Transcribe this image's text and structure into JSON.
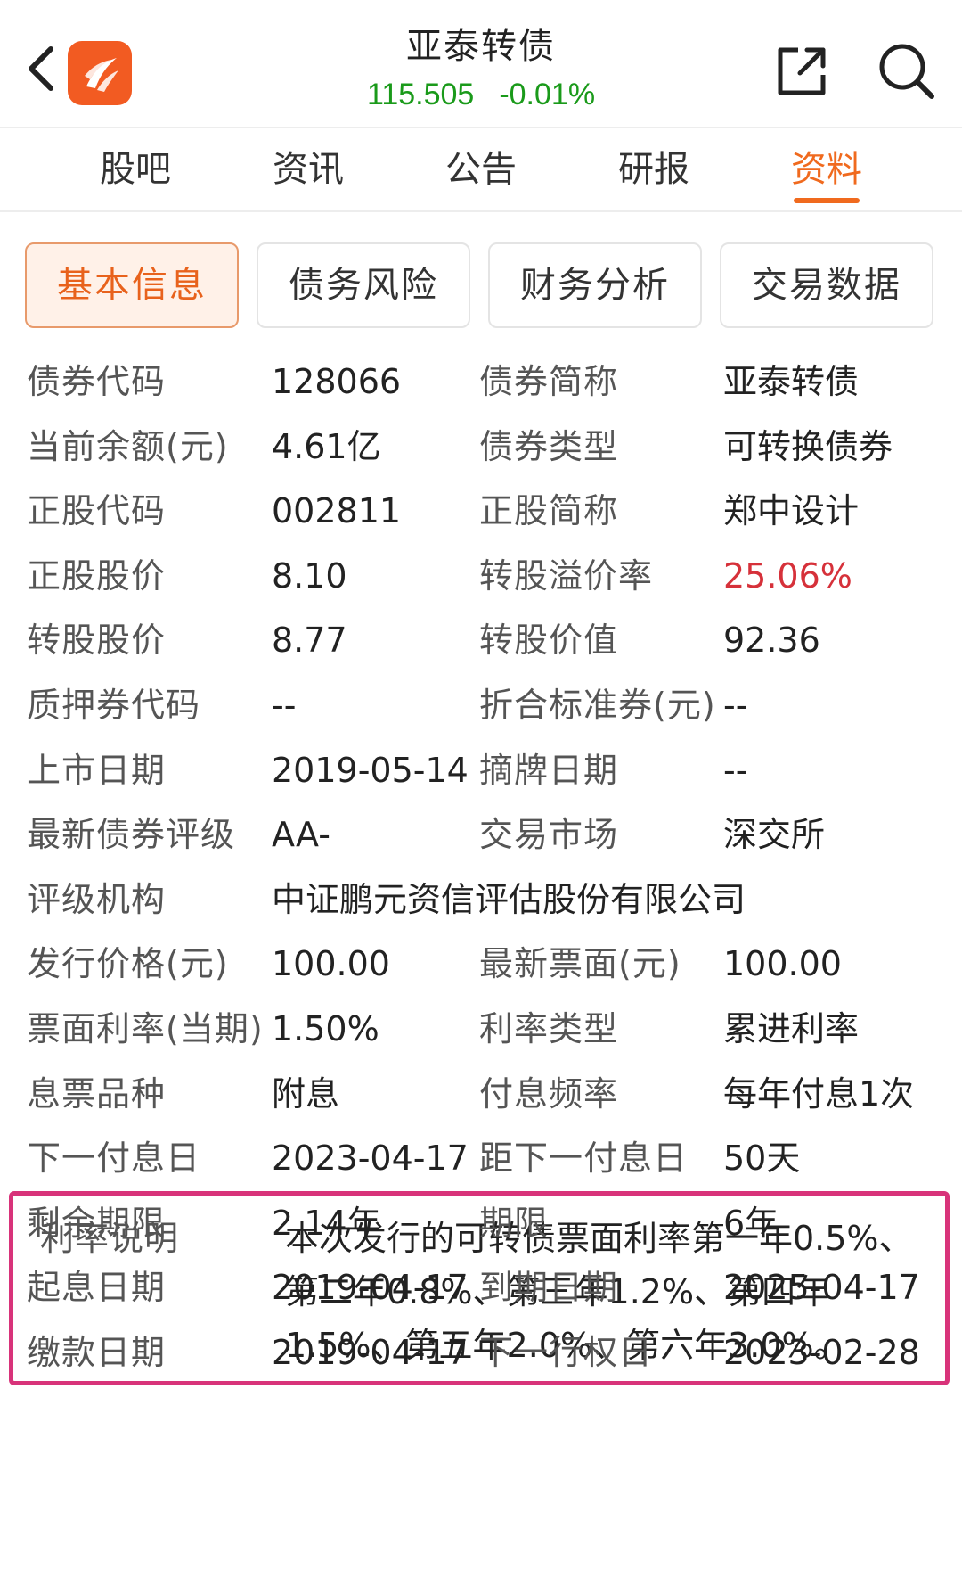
{
  "header": {
    "title": "亚泰转债",
    "price": "115.505",
    "change": "-0.01%"
  },
  "icons": {
    "back": "chevron-left-icon",
    "logo": "app-logo-icon",
    "share": "share-external-icon",
    "search": "search-icon"
  },
  "colors": {
    "accent": "#f06a1e",
    "quote_green": "#1a9a1a",
    "premium_red": "#d6313a",
    "highlight_border": "#d8337a"
  },
  "main_tabs": [
    {
      "label": "股吧"
    },
    {
      "label": "资讯"
    },
    {
      "label": "公告"
    },
    {
      "label": "研报"
    },
    {
      "label": "资料",
      "active": true
    }
  ],
  "sub_tabs": [
    {
      "label": "基本信息",
      "active": true
    },
    {
      "label": "债务风险"
    },
    {
      "label": "财务分析"
    },
    {
      "label": "交易数据"
    }
  ],
  "info_rows_top": [
    {
      "l1": "债券代码",
      "v1": "128066",
      "l2": "债券简称",
      "v2": "亚泰转债"
    },
    {
      "l1": "当前余额(元)",
      "v1": "4.61亿",
      "l2": "债券类型",
      "v2": "可转换债券"
    },
    {
      "l1": "正股代码",
      "v1": "002811",
      "l2": "正股简称",
      "v2": "郑中设计"
    },
    {
      "l1": "正股股价",
      "v1": "8.10",
      "l2": "转股溢价率",
      "v2": "25.06%"
    },
    {
      "l1": "转股股价",
      "v1": "8.77",
      "l2": "转股价值",
      "v2": "92.36"
    },
    {
      "l1": "质押券代码",
      "v1": "--",
      "l2": "折合标准券(元)",
      "v2": "--"
    },
    {
      "l1": "上市日期",
      "v1": "2019-05-14",
      "l2": "摘牌日期",
      "v2": "--"
    },
    {
      "l1": "最新债券评级",
      "v1": "AA-",
      "l2": "交易市场",
      "v2": "深交所"
    },
    {
      "l1": "评级机构",
      "v1": "中证鹏元资信评估股份有限公司",
      "l2": "",
      "v2": ""
    },
    {
      "l1": "发行价格(元)",
      "v1": "100.00",
      "l2": "最新票面(元)",
      "v2": "100.00"
    },
    {
      "l1": "票面利率(当期)",
      "v1": "1.50%",
      "l2": "利率类型",
      "v2": "累进利率"
    },
    {
      "l1": "息票品种",
      "v1": "附息",
      "l2": "付息频率",
      "v2": "每年付息1次"
    },
    {
      "l1": "下一付息日",
      "v1": "2023-04-17",
      "l2": "距下一付息日",
      "v2": "50天"
    }
  ],
  "rate_note": {
    "label": "利率说明",
    "text": "本次发行的可转债票面利率第一年0.5%、第二年0.8%、第三年1.2%、第四年1.5%、第五年2.0%、第六年3.0%。"
  },
  "info_rows_bottom": [
    {
      "l1": "剩余期限",
      "v1": "2.14年",
      "l2": "期限",
      "v2": "6年"
    },
    {
      "l1": "起息日期",
      "v1": "2019-04-17",
      "l2": "到期日期",
      "v2": "2025-04-17"
    },
    {
      "l1": "缴款日期",
      "v1": "2019-04-17",
      "l2": "下一行权日",
      "v2": "2023-02-28"
    }
  ]
}
